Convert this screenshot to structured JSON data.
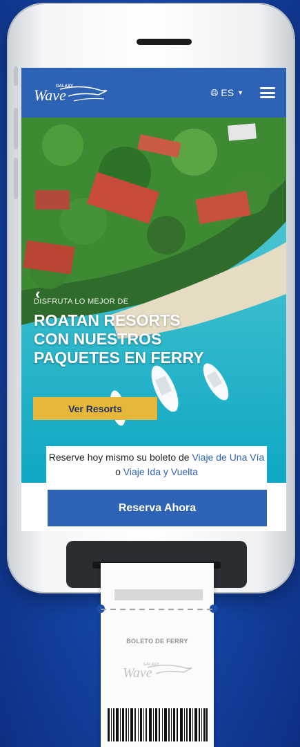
{
  "brand": {
    "logo_top": "GALAXY",
    "logo_main": "Wave"
  },
  "header": {
    "language": "ES"
  },
  "hero": {
    "kicker": "DISFRUTA LO MEJOR DE",
    "title": "ROATAN RESORTS CON NUESTROS PAQUETES EN FERRY",
    "button_label": "Ver Resorts"
  },
  "reserve": {
    "text_before": "Reserve hoy mismo su boleto de ",
    "link_one_way": "Viaje de Una Vía",
    "text_or": " o ",
    "link_round_trip": "Viaje Ida y Vuelta",
    "cta_label": "Reserva Ahora"
  },
  "ticket": {
    "title": "BOLETO DE FERRY"
  },
  "colors": {
    "header_blue": "#2d62b4",
    "accent_yellow": "#e7b73a",
    "background_blue": "#1649ad"
  }
}
